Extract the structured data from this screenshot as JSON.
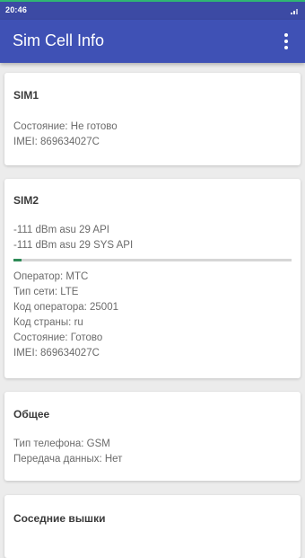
{
  "status_bar": {
    "time": "20:46"
  },
  "app_bar": {
    "title": "Sim Cell Info"
  },
  "sim1": {
    "title": "SIM1",
    "state": "Состояние: Не готово",
    "imei": "IMEI: 869634027C"
  },
  "sim2": {
    "title": "SIM2",
    "signal_api": "-111 dBm asu 29 API",
    "signal_sys_api": "-111 dBm asu 29 SYS API",
    "signal_level": 0.03,
    "operator": "Оператор: МТС",
    "network_type": "Тип сети: LTE",
    "operator_code": "Код оператора: 25001",
    "country_code": "Код страны: ru",
    "state": "Состояние: Готово",
    "imei": "IMEI: 869634027C"
  },
  "general": {
    "title": "Общее",
    "phone_type": "Тип телефона: GSM",
    "data_transfer": "Передача данных: Нет"
  },
  "neighbors": {
    "title": "Соседние вышки"
  },
  "colors": {
    "primary": "#3f51b5",
    "primary_dark": "#3c4aa4",
    "accent_signal": "#2e8b57"
  }
}
